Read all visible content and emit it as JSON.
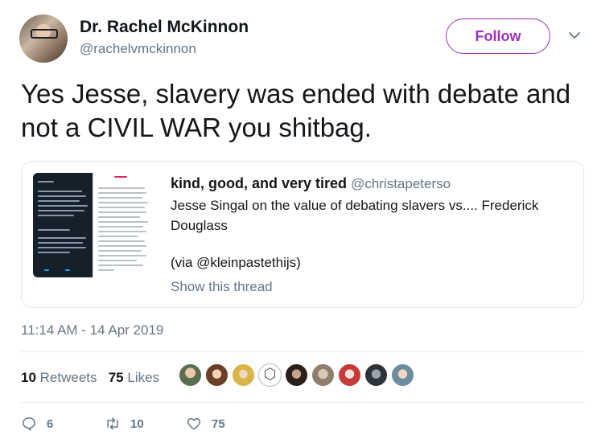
{
  "tweet": {
    "author_name": "Dr. Rachel McKinnon",
    "author_handle": "@rachelvmckinnon",
    "follow_label": "Follow",
    "text": "Yes Jesse, slavery was ended with debate and not a CIVIL WAR you shitbag.",
    "timestamp": "11:14 AM - 14 Apr 2019"
  },
  "quoted": {
    "author_name": "kind, good, and very tired",
    "author_handle": "@christapeterso",
    "text": "Jesse Singal on the value of debating slavers vs.... Frederick Douglass",
    "via": "(via @kleinpastethijs)",
    "show_thread": "Show this thread"
  },
  "stats": {
    "retweets_count": "10",
    "retweets_label": "Retweets",
    "likes_count": "75",
    "likes_label": "Likes"
  },
  "actions": {
    "reply_count": "6",
    "retweet_count": "10",
    "like_count": "75"
  },
  "colors": {
    "accent": "#9a33b8",
    "text_secondary": "#657786",
    "border": "#e1e8ed"
  }
}
